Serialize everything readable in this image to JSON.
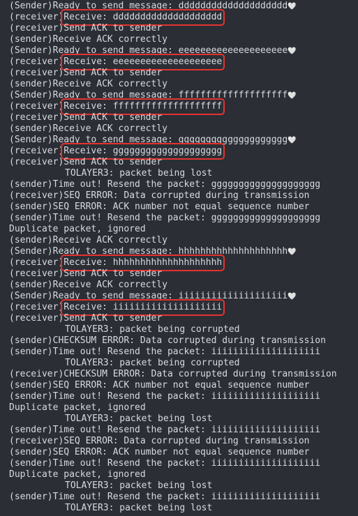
{
  "terminal": {
    "lines": [
      {
        "prefix": "(Sender)",
        "text": "Ready to send message: dddddddddddddddddddd",
        "tail": "🤍",
        "highlight": false
      },
      {
        "prefix": "(receiver)",
        "text": "Receive: dddddddddddddddddddd",
        "tail": "",
        "highlight": true
      },
      {
        "prefix": "(receiver)",
        "text": "Send ACK to sender",
        "tail": "",
        "highlight": false
      },
      {
        "prefix": "(sender)",
        "text": "Receive ACK correctly",
        "tail": "",
        "highlight": false
      },
      {
        "prefix": "(Sender)",
        "text": "Ready to send message: eeeeeeeeeeeeeeeeeeee",
        "tail": "🤍",
        "highlight": false
      },
      {
        "prefix": "(receiver)",
        "text": "Receive: eeeeeeeeeeeeeeeeeeee",
        "tail": "",
        "highlight": true
      },
      {
        "prefix": "(receiver)",
        "text": "Send ACK to sender",
        "tail": "",
        "highlight": false
      },
      {
        "prefix": "(sender)",
        "text": "Receive ACK correctly",
        "tail": "",
        "highlight": false
      },
      {
        "prefix": "(Sender)",
        "text": "Ready to send message: ffffffffffffffffffff",
        "tail": "🤍",
        "highlight": false
      },
      {
        "prefix": "(receiver)",
        "text": "Receive: ffffffffffffffffffff",
        "tail": "",
        "highlight": true
      },
      {
        "prefix": "(receiver)",
        "text": "Send ACK to sender",
        "tail": "",
        "highlight": false
      },
      {
        "prefix": "(sender)",
        "text": "Receive ACK correctly",
        "tail": "",
        "highlight": false
      },
      {
        "prefix": "(Sender)",
        "text": "Ready to send message: gggggggggggggggggggg",
        "tail": "🤍",
        "highlight": false
      },
      {
        "prefix": "(receiver)",
        "text": "Receive: gggggggggggggggggggg",
        "tail": "",
        "highlight": true
      },
      {
        "prefix": "(receiver)",
        "text": "Send ACK to sender",
        "tail": "",
        "highlight": false
      },
      {
        "prefix": "",
        "text": "TOLAYER3: packet being lost",
        "tail": "",
        "highlight": false,
        "indent": true
      },
      {
        "prefix": "(sender)",
        "text": "Time out! Resend the packet: gggggggggggggggggggg",
        "tail": "",
        "highlight": false
      },
      {
        "prefix": "(receiver)",
        "text": "SEQ ERROR: Data corrupted during transmission",
        "tail": "",
        "highlight": false
      },
      {
        "prefix": "(sender)",
        "text": "SEQ ERROR: ACK number not equal sequence number",
        "tail": "",
        "highlight": false
      },
      {
        "prefix": "(sender)",
        "text": "Time out! Resend the packet: gggggggggggggggggggg",
        "tail": "",
        "highlight": false
      },
      {
        "prefix": "",
        "text": "Duplicate packet, ignored",
        "tail": "",
        "highlight": false
      },
      {
        "prefix": "(sender)",
        "text": "Receive ACK correctly",
        "tail": "",
        "highlight": false
      },
      {
        "prefix": "(Sender)",
        "text": "Ready to send message: hhhhhhhhhhhhhhhhhhhh",
        "tail": "🤍",
        "highlight": false
      },
      {
        "prefix": "(receiver)",
        "text": "Receive: hhhhhhhhhhhhhhhhhhhh",
        "tail": "",
        "highlight": true
      },
      {
        "prefix": "(receiver)",
        "text": "Send ACK to sender",
        "tail": "",
        "highlight": false
      },
      {
        "prefix": "(sender)",
        "text": "Receive ACK correctly",
        "tail": "",
        "highlight": false
      },
      {
        "prefix": "(Sender)",
        "text": "Ready to send message: iiiiiiiiiiiiiiiiiiii",
        "tail": "🤍",
        "highlight": false
      },
      {
        "prefix": "(receiver)",
        "text": "Receive: iiiiiiiiiiiiiiiiiiii",
        "tail": "",
        "highlight": true
      },
      {
        "prefix": "(receiver)",
        "text": "Send ACK to sender",
        "tail": "",
        "highlight": false
      },
      {
        "prefix": "",
        "text": "TOLAYER3: packet being corrupted",
        "tail": "",
        "highlight": false,
        "indent": true
      },
      {
        "prefix": "(sender)",
        "text": "CHECKSUM ERROR: Data corrupted during transmission",
        "tail": "",
        "highlight": false
      },
      {
        "prefix": "(sender)",
        "text": "Time out! Resend the packet: iiiiiiiiiiiiiiiiiiii",
        "tail": "",
        "highlight": false
      },
      {
        "prefix": "",
        "text": "TOLAYER3: packet being corrupted",
        "tail": "",
        "highlight": false,
        "indent": true
      },
      {
        "prefix": "(receiver)",
        "text": "CHECKSUM ERROR: Data corrupted during transmission",
        "tail": "",
        "highlight": false
      },
      {
        "prefix": "(sender)",
        "text": "SEQ ERROR: ACK number not equal sequence number",
        "tail": "",
        "highlight": false
      },
      {
        "prefix": "(sender)",
        "text": "Time out! Resend the packet: iiiiiiiiiiiiiiiiiiii",
        "tail": "",
        "highlight": false
      },
      {
        "prefix": "",
        "text": "Duplicate packet, ignored",
        "tail": "",
        "highlight": false
      },
      {
        "prefix": "",
        "text": "TOLAYER3: packet being lost",
        "tail": "",
        "highlight": false,
        "indent": true
      },
      {
        "prefix": "(sender)",
        "text": "Time out! Resend the packet: iiiiiiiiiiiiiiiiiiii",
        "tail": "",
        "highlight": false
      },
      {
        "prefix": "(receiver)",
        "text": "SEQ ERROR: Data corrupted during transmission",
        "tail": "",
        "highlight": false
      },
      {
        "prefix": "(sender)",
        "text": "SEQ ERROR: ACK number not equal sequence number",
        "tail": "",
        "highlight": false
      },
      {
        "prefix": "(sender)",
        "text": "Time out! Resend the packet: iiiiiiiiiiiiiiiiiiii",
        "tail": "",
        "highlight": false
      },
      {
        "prefix": "",
        "text": "Duplicate packet, ignored",
        "tail": "",
        "highlight": false
      },
      {
        "prefix": "",
        "text": "TOLAYER3: packet being lost",
        "tail": "",
        "highlight": false,
        "indent": true
      },
      {
        "prefix": "(sender)",
        "text": "Time out! Resend the packet: iiiiiiiiiiiiiiiiiiii",
        "tail": "",
        "highlight": false
      },
      {
        "prefix": "",
        "text": "TOLAYER3: packet being lost",
        "tail": "",
        "highlight": false,
        "indent": true
      }
    ]
  },
  "colors": {
    "background": "#2b2e35",
    "text": "#d7dbe0",
    "highlight_border": "#e4332f"
  }
}
